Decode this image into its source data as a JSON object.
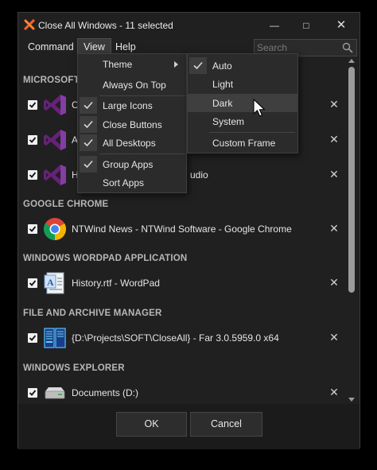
{
  "window": {
    "title": "Close All Windows - 11 selected",
    "controls": {
      "minimize": "—",
      "maximize": "□",
      "close": "✕"
    }
  },
  "menubar": {
    "items": [
      "Command",
      "View",
      "Help"
    ],
    "active": "View"
  },
  "search": {
    "placeholder": "Search",
    "value": ""
  },
  "groups": [
    {
      "header": "MICROSOFT",
      "rows": [
        {
          "title": "C",
          "icon": "visual-studio-icon",
          "checked": true
        },
        {
          "title": "A",
          "icon": "visual-studio-icon",
          "checked": true
        },
        {
          "title": "H",
          "suffix": "udio",
          "icon": "visual-studio-icon",
          "checked": true
        }
      ]
    },
    {
      "header": "GOOGLE CHROME",
      "rows": [
        {
          "title": "NTWind News - NTWind Software - Google Chrome",
          "icon": "chrome-icon",
          "checked": true
        }
      ]
    },
    {
      "header": "WINDOWS WORDPAD APPLICATION",
      "rows": [
        {
          "title": "History.rtf - WordPad",
          "icon": "wordpad-icon",
          "checked": true
        }
      ]
    },
    {
      "header": "FILE AND ARCHIVE MANAGER",
      "rows": [
        {
          "title": "{D:\\Projects\\SOFT\\CloseAll} - Far 3.0.5959.0 x64",
          "icon": "far-manager-icon",
          "checked": true
        }
      ]
    },
    {
      "header": "WINDOWS EXPLORER",
      "rows": [
        {
          "title": "Documents (D:)",
          "icon": "drive-icon",
          "checked": true
        }
      ]
    }
  ],
  "view_menu": {
    "items": [
      {
        "label": "Theme",
        "checked": false,
        "submenu": true
      },
      {
        "label": "Always On Top",
        "checked": false
      },
      {
        "label": "Large Icons",
        "checked": true
      },
      {
        "label": "Close Buttons",
        "checked": true
      },
      {
        "label": "All Desktops",
        "checked": true
      },
      {
        "label": "Group Apps",
        "checked": true
      },
      {
        "label": "Sort Apps",
        "checked": false
      }
    ]
  },
  "theme_menu": {
    "items": [
      {
        "label": "Auto",
        "checked": true
      },
      {
        "label": "Light",
        "checked": false
      },
      {
        "label": "Dark",
        "checked": false,
        "highlighted": true
      },
      {
        "label": "System",
        "checked": false
      },
      {
        "label": "Custom Frame",
        "checked": false
      }
    ]
  },
  "footer": {
    "ok_label": "OK",
    "cancel_label": "Cancel"
  },
  "colors": {
    "background": "#202020",
    "menu": "#2b2b2b",
    "accent_vs": "#68217a",
    "checkmark": "#d8d8d8"
  }
}
